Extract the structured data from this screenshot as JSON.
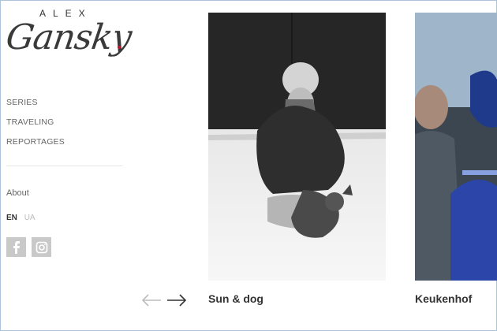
{
  "logo": {
    "top": "ALEX",
    "script": "Gansky"
  },
  "nav": {
    "items": [
      "SERIES",
      "TRAVELING",
      "REPORTAGES"
    ]
  },
  "about": "About",
  "lang": {
    "active": "EN",
    "inactive": "UA"
  },
  "social": [
    {
      "icon": "facebook-icon"
    },
    {
      "icon": "instagram-icon"
    }
  ],
  "gallery": {
    "items": [
      {
        "caption": "Sun & dog"
      },
      {
        "caption": "Keukenhof"
      }
    ]
  },
  "colors": {
    "accent_dot": "#c8102e",
    "social_bg": "#c9c9c9",
    "text": "#333333"
  }
}
